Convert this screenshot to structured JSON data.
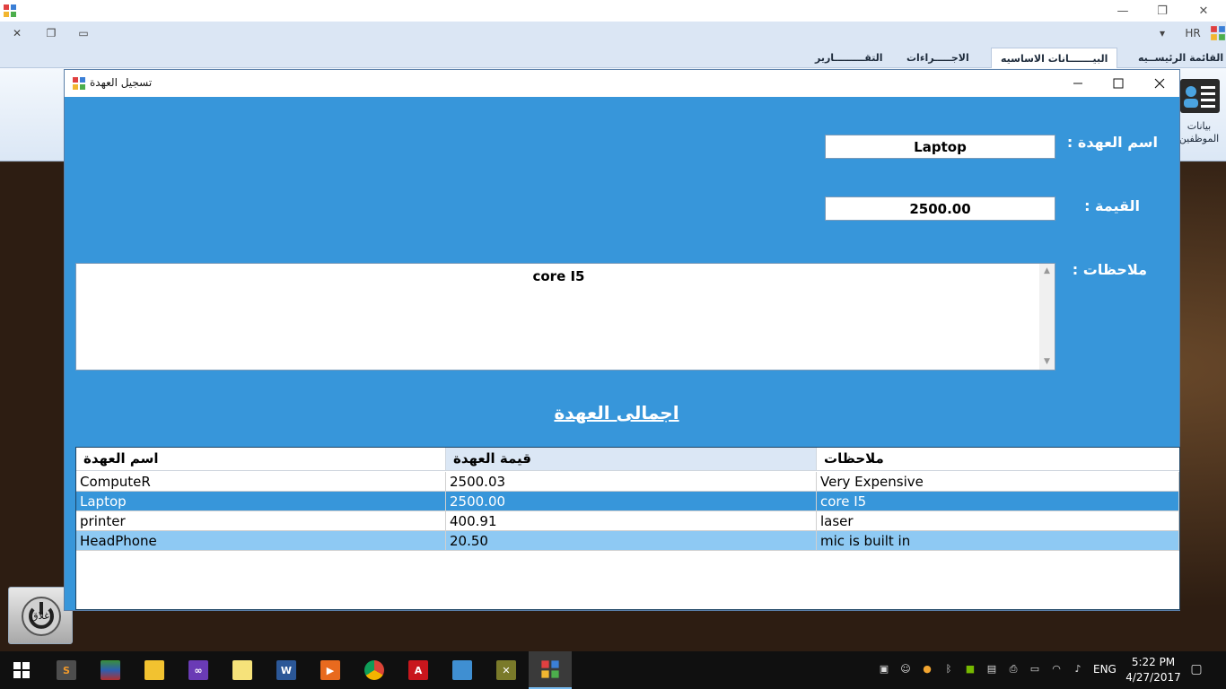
{
  "window": {
    "minimize": "—",
    "restore": "❐",
    "close": "✕"
  },
  "mdi": {
    "close": "✕",
    "restore": "❐",
    "minimize": "▭",
    "dropdown": "▾",
    "user": "HR"
  },
  "ribbon": {
    "tabs": [
      "القائمة الرئيســيه",
      "البيـــــــانات الاساسيه",
      "الاجـــــراءات",
      "التقـــــــــارير"
    ],
    "active_tab": "البيـــــــانات الاساسيه",
    "employee_button": "بيانات الموظفين"
  },
  "dialog": {
    "title": "تسجيل العهدة",
    "name_label": "اسم العهدة :",
    "name_value": "Laptop",
    "value_label": "القيمة :",
    "value_value": "2500.00",
    "notes_label": "ملاحظات :",
    "notes_value": "core I5",
    "summary_title": "اجمالى العهدة"
  },
  "grid": {
    "columns": [
      "اسم العهدة",
      "قيمة العهدة",
      "ملاحظات"
    ],
    "rows": [
      {
        "name": "ComputeR",
        "value": "2500.03",
        "notes": "Very Expensive"
      },
      {
        "name": "Laptop",
        "value": "2500.00",
        "notes": "core I5"
      },
      {
        "name": "printer",
        "value": "400.91",
        "notes": "laser"
      },
      {
        "name": "HeadPhone",
        "value": "20.50",
        "notes": "mic is built in"
      }
    ],
    "selected_row": 1
  },
  "exit_button": "اغلاق",
  "taskbar": {
    "lang": "ENG",
    "time": "5:22 PM",
    "date": "4/27/2017"
  },
  "colors": {
    "dialog_bg": "#3796da",
    "selected_row": "#3796da",
    "alt_row": "#8ec9f3"
  }
}
